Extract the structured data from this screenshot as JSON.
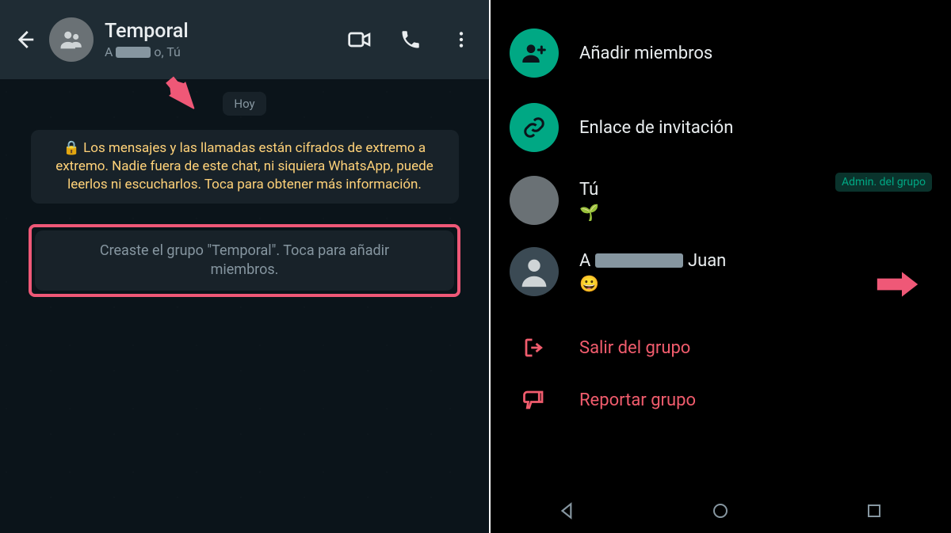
{
  "chat": {
    "title": "Temporal",
    "subtitle_prefix": "A",
    "subtitle_suffix": "o, Tú",
    "date_chip": "Hoy",
    "encryption_notice": "Los mensajes y las llamadas están cifrados de extremo a extremo. Nadie fuera de este chat, ni siquiera WhatsApp, puede leerlos ni escucharlos. Toca para obtener más información.",
    "system_message": "Creaste el grupo \"Temporal\". Toca para añadir miembros."
  },
  "info": {
    "add_members": "Añadir miembros",
    "invite_link": "Enlace de invitación",
    "members": [
      {
        "name": "Tú",
        "status": "🌱",
        "is_admin": true,
        "redacted": false
      },
      {
        "name_prefix": "A",
        "name_suffix": "Juan",
        "status": "😀",
        "is_admin": false,
        "redacted": true
      }
    ],
    "admin_badge": "Admin. del grupo",
    "leave_group": "Salir del grupo",
    "report_group": "Reportar grupo"
  },
  "colors": {
    "accent_green": "#00a884",
    "danger": "#f15c6d",
    "highlight_box": "#ef5877",
    "arrow": "#ef5877"
  }
}
